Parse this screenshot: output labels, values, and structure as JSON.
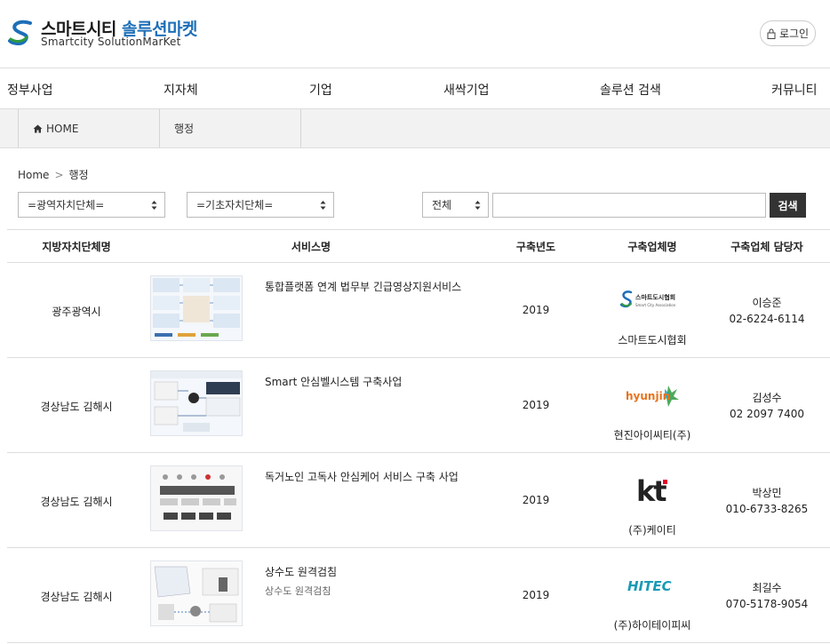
{
  "header": {
    "logo_title_main": "스마트시티 ",
    "logo_title_accent": "솔루션마켓",
    "logo_subtitle": "Smartcity SolutionMarKet",
    "login_label": "로그인"
  },
  "nav": {
    "items": [
      {
        "label": "정부사업"
      },
      {
        "label": "지자체"
      },
      {
        "label": "기업"
      },
      {
        "label": "새싹기업"
      },
      {
        "label": "솔루션 검색"
      },
      {
        "label": "커뮤니티"
      }
    ]
  },
  "breadcrumb_bar": {
    "home": "HOME",
    "current": "행정"
  },
  "subcrumb": {
    "home": "Home",
    "separator": ">",
    "current": "행정"
  },
  "filters": {
    "region_wide": "=광역자치단체=",
    "region_basic": "=기초자치단체=",
    "scope": "전체",
    "search_value": "",
    "search_button": "검색"
  },
  "table": {
    "columns": [
      "지방자치단체명",
      "서비스명",
      "구축년도",
      "구축업체명",
      "구축업체 담당자"
    ],
    "rows": [
      {
        "region": "광주광역시",
        "service": "통합플랫폼 연계 법무부 긴급영상지원서비스",
        "description": "",
        "year": "2019",
        "logo": "smart-city-association-logo",
        "logo_text": "스마트도시협회",
        "logo_subtext": "Smart City Association",
        "company": "스마트도시협회",
        "contact_name": "이승준",
        "contact_phone": "02-6224-6114"
      },
      {
        "region": "경상남도 김해시",
        "service": "Smart 안심벨시스템 구축사업",
        "description": "",
        "year": "2019",
        "logo": "hyunjin-logo",
        "logo_text": "hyunjin",
        "logo_subtext": "",
        "company": "현진아이씨티(주)",
        "contact_name": "김성수",
        "contact_phone": "02 2097 7400"
      },
      {
        "region": "경상남도 김해시",
        "service": "독거노인 고독사 안심케어 서비스 구축 사업",
        "description": "",
        "year": "2019",
        "logo": "kt-logo",
        "logo_text": "kt",
        "logo_subtext": "",
        "company": "(주)케이티",
        "contact_name": "박상민",
        "contact_phone": "010-6733-8265"
      },
      {
        "region": "경상남도 김해시",
        "service": "상수도 원격검침",
        "description": "상수도 원격검침",
        "year": "2019",
        "logo": "hitec-logo",
        "logo_text": "HITEC",
        "logo_subtext": "",
        "company": "(주)하이테이피씨",
        "contact_name": "최길수",
        "contact_phone": "070-5178-9054"
      }
    ]
  },
  "colors": {
    "accent_blue": "#1d6fb8",
    "logo_green": "#2f9a3e",
    "hyunjin_orange": "#e8721c",
    "kt_red": "#e4002b",
    "hitec_teal": "#1a9bb5",
    "dark_button": "#333333"
  }
}
